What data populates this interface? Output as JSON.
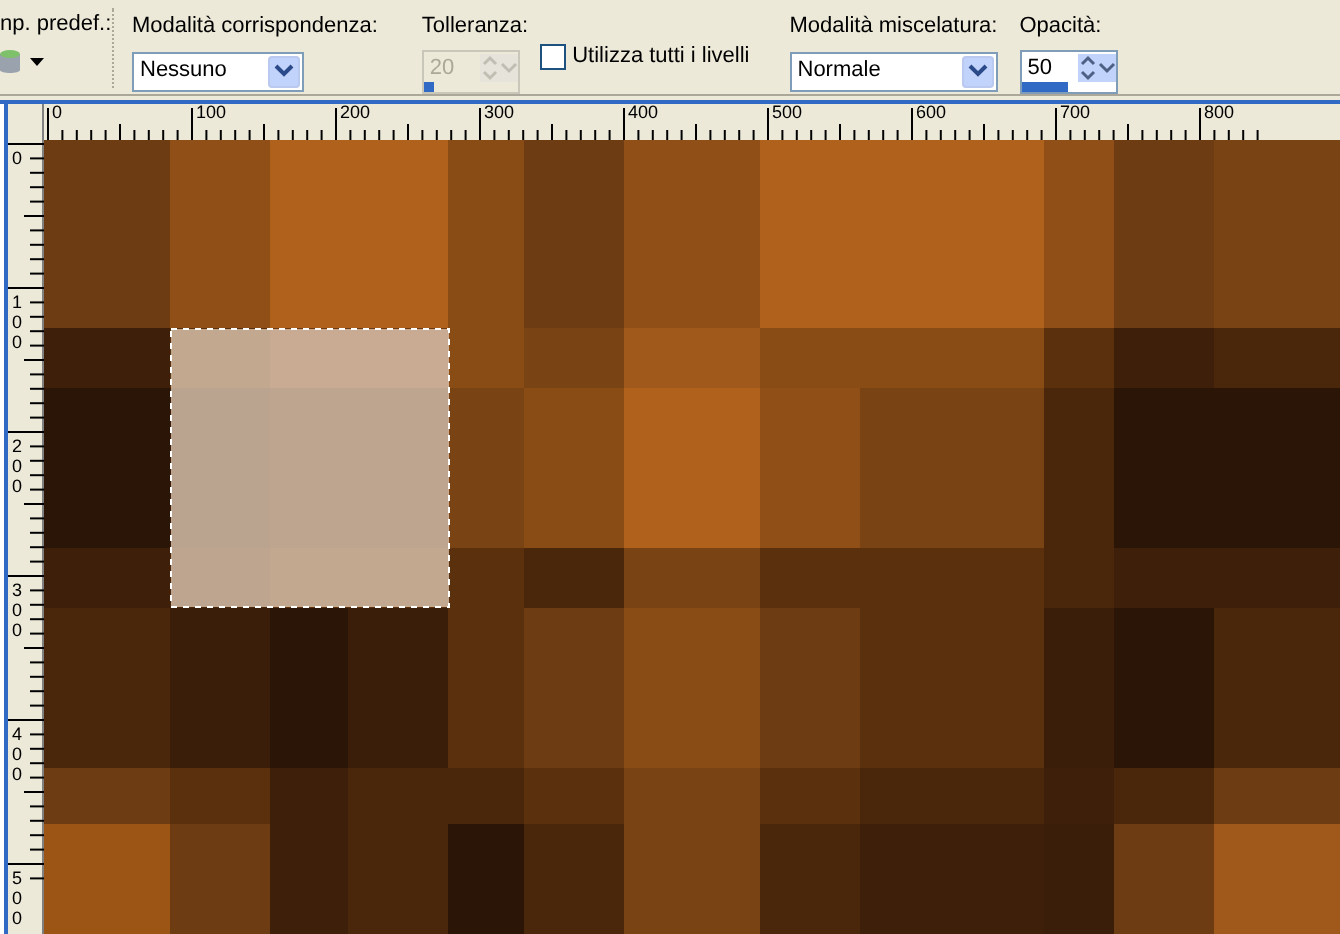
{
  "toolbar": {
    "preset_label": "np. predef.:",
    "match_mode": {
      "label": "Modalità corrispondenza:",
      "value": "Nessuno"
    },
    "tolerance": {
      "label": "Tolleranza:",
      "value": "20",
      "disabled": true,
      "level": 0.1
    },
    "use_all_layers": {
      "label": "Utilizza tutti i livelli",
      "checked": false
    },
    "blend_mode": {
      "label": "Modalità miscelatura:",
      "value": "Normale"
    },
    "opacity": {
      "label": "Opacità:",
      "value": "50",
      "level": 0.5
    }
  },
  "rulers": {
    "horizontal": [
      "0",
      "100",
      "200",
      "300",
      "400",
      "500",
      "600",
      "700",
      "800"
    ],
    "vertical": [
      "0",
      "100",
      "200",
      "300",
      "400",
      "500"
    ]
  }
}
